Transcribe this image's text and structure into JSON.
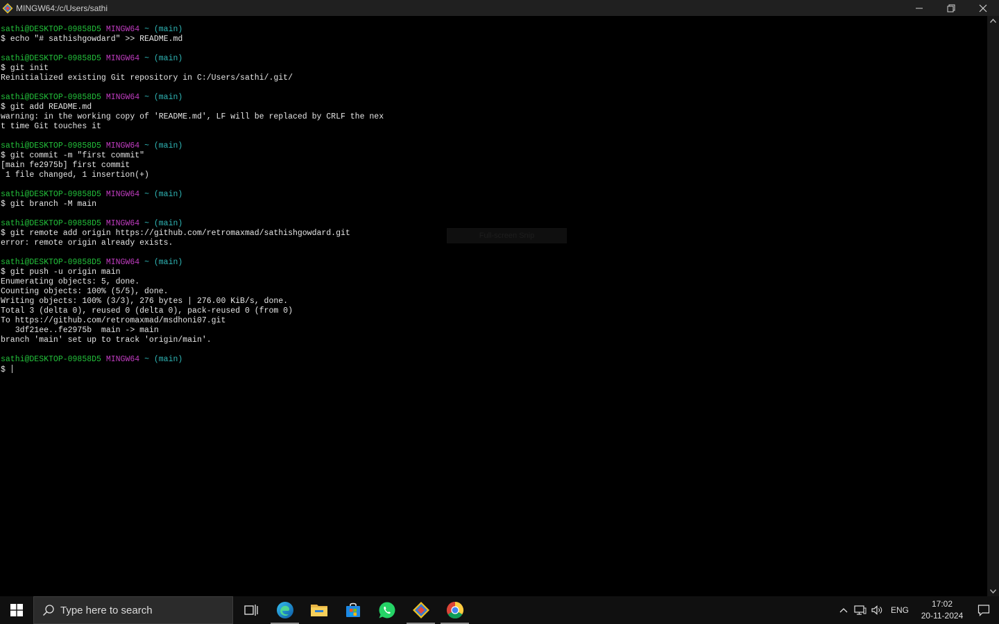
{
  "window": {
    "title": "MINGW64:/c/Users/sathi",
    "controls": [
      "minimize",
      "restore",
      "close"
    ]
  },
  "prompt": {
    "user": "sathi@DESKTOP-09858D5",
    "env": "MINGW64",
    "path": "~",
    "branch": "(main)"
  },
  "terminal": {
    "lines": [
      {
        "type": "prompt"
      },
      {
        "type": "text",
        "text": "$ echo \"# sathishgowdard\" >> README.md"
      },
      {
        "type": "blank"
      },
      {
        "type": "prompt"
      },
      {
        "type": "text",
        "text": "$ git init"
      },
      {
        "type": "text",
        "text": "Reinitialized existing Git repository in C:/Users/sathi/.git/"
      },
      {
        "type": "blank"
      },
      {
        "type": "prompt"
      },
      {
        "type": "text",
        "text": "$ git add README.md"
      },
      {
        "type": "text",
        "text": "warning: in the working copy of 'README.md', LF will be replaced by CRLF the nex"
      },
      {
        "type": "text",
        "text": "t time Git touches it"
      },
      {
        "type": "blank"
      },
      {
        "type": "prompt"
      },
      {
        "type": "text",
        "text": "$ git commit -m \"first commit\""
      },
      {
        "type": "text",
        "text": "[main fe2975b] first commit"
      },
      {
        "type": "text",
        "text": " 1 file changed, 1 insertion(+)"
      },
      {
        "type": "blank"
      },
      {
        "type": "prompt"
      },
      {
        "type": "text",
        "text": "$ git branch -M main"
      },
      {
        "type": "blank"
      },
      {
        "type": "prompt"
      },
      {
        "type": "text",
        "text": "$ git remote add origin https://github.com/retromaxmad/sathishgowdard.git"
      },
      {
        "type": "text",
        "text": "error: remote origin already exists."
      },
      {
        "type": "blank"
      },
      {
        "type": "prompt"
      },
      {
        "type": "text",
        "text": "$ git push -u origin main"
      },
      {
        "type": "text",
        "text": "Enumerating objects: 5, done."
      },
      {
        "type": "text",
        "text": "Counting objects: 100% (5/5), done."
      },
      {
        "type": "text",
        "text": "Writing objects: 100% (3/3), 276 bytes | 276.00 KiB/s, done."
      },
      {
        "type": "text",
        "text": "Total 3 (delta 0), reused 0 (delta 0), pack-reused 0 (from 0)"
      },
      {
        "type": "text",
        "text": "To https://github.com/retromaxmad/msdhoni07.git"
      },
      {
        "type": "text",
        "text": "   3df21ee..fe2975b  main -> main"
      },
      {
        "type": "text",
        "text": "branch 'main' set up to track 'origin/main'."
      },
      {
        "type": "blank"
      },
      {
        "type": "prompt"
      },
      {
        "type": "input",
        "text": "$ "
      }
    ],
    "colors": {
      "user": "#23c23b",
      "env": "#c03cc0",
      "branch": "#2fb6b6",
      "text": "#e6e6e6"
    }
  },
  "overlay": {
    "snip_label": "Full-screen Snip"
  },
  "taskbar": {
    "search_placeholder": "Type here to search",
    "apps": [
      {
        "name": "task-view",
        "icon": "task-view-icon"
      },
      {
        "name": "edge",
        "icon": "edge-icon"
      },
      {
        "name": "file-explorer",
        "icon": "folder-icon"
      },
      {
        "name": "store",
        "icon": "store-icon"
      },
      {
        "name": "whatsapp",
        "icon": "whatsapp-icon"
      },
      {
        "name": "git-bash",
        "icon": "git-icon"
      },
      {
        "name": "chrome",
        "icon": "chrome-icon"
      }
    ],
    "language": "ENG",
    "time": "17:02",
    "date": "20-11-2024"
  }
}
